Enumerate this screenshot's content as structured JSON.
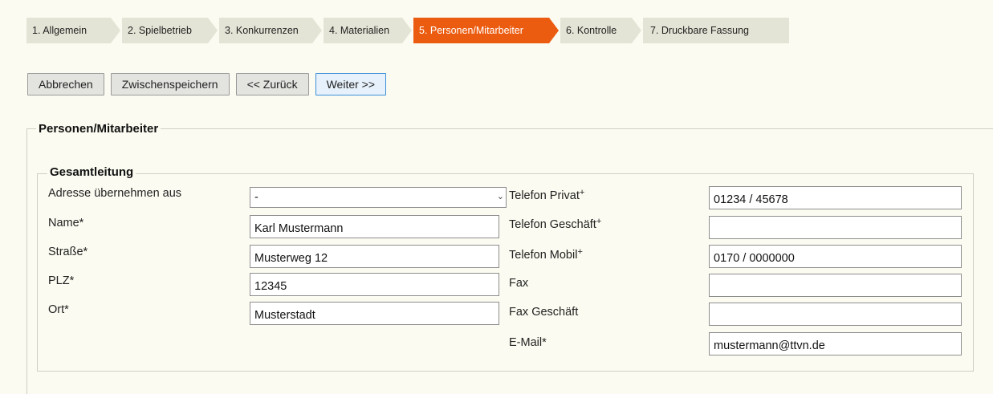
{
  "steps": [
    {
      "label": "1. Allgemein",
      "active": false
    },
    {
      "label": "2. Spielbetrieb",
      "active": false
    },
    {
      "label": "3. Konkurrenzen",
      "active": false
    },
    {
      "label": "4. Materialien",
      "active": false
    },
    {
      "label": "5. Personen/Mitarbeiter",
      "active": true
    },
    {
      "label": "6. Kontrolle",
      "active": false
    },
    {
      "label": "7. Druckbare Fassung",
      "active": false
    }
  ],
  "toolbar": {
    "cancel": "Abbrechen",
    "save_draft": "Zwischenspeichern",
    "back": "<< Zurück",
    "next": "Weiter >>"
  },
  "section": {
    "title": "Personen/Mitarbeiter",
    "group_title": "Gesamtleitung"
  },
  "left_fields": {
    "address_from": {
      "label": "Adresse übernehmen aus",
      "value": "-"
    },
    "name": {
      "label": "Name*",
      "value": "Karl Mustermann"
    },
    "street": {
      "label": "Straße*",
      "value": "Musterweg 12"
    },
    "zip": {
      "label": "PLZ*",
      "value": "12345"
    },
    "city": {
      "label": "Ort*",
      "value": "Musterstadt"
    }
  },
  "right_fields": {
    "phone_private": {
      "label": "Telefon Privat",
      "sup": "+",
      "value": "01234 / 45678"
    },
    "phone_business": {
      "label": "Telefon Geschäft",
      "sup": "+",
      "value": ""
    },
    "phone_mobile": {
      "label": "Telefon Mobil",
      "sup": "+",
      "value": "0170 / 0000000"
    },
    "fax": {
      "label": "Fax",
      "value": ""
    },
    "fax_business": {
      "label": "Fax Geschäft",
      "value": ""
    },
    "email": {
      "label": "E-Mail*",
      "value": "mustermann@ttvn.de"
    }
  },
  "colors": {
    "active_step": "#ec5c10",
    "step_bg": "#e4e4d6",
    "page_bg": "#fbfbf1",
    "primary_button_border": "#3c8fd8"
  }
}
